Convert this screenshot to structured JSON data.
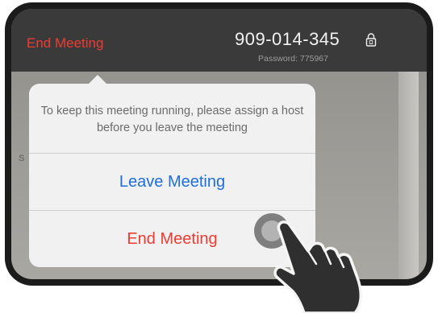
{
  "header": {
    "end_meeting_label": "End Meeting",
    "meeting_id": "909-014-345",
    "password_text": "Password: 775967"
  },
  "background": {
    "partial_label": "S"
  },
  "popover": {
    "message": "To keep this meeting running, please assign a host before you leave the meeting",
    "leave_label": "Leave Meeting",
    "end_label": "End Meeting"
  },
  "icons": {
    "lock": "lock-icon",
    "hand": "pointing-hand-icon",
    "tap": "tap-indicator"
  },
  "colors": {
    "end_red": "#ee3c33",
    "leave_blue": "#1e6fd9",
    "topbar": "#3a3a3a"
  }
}
